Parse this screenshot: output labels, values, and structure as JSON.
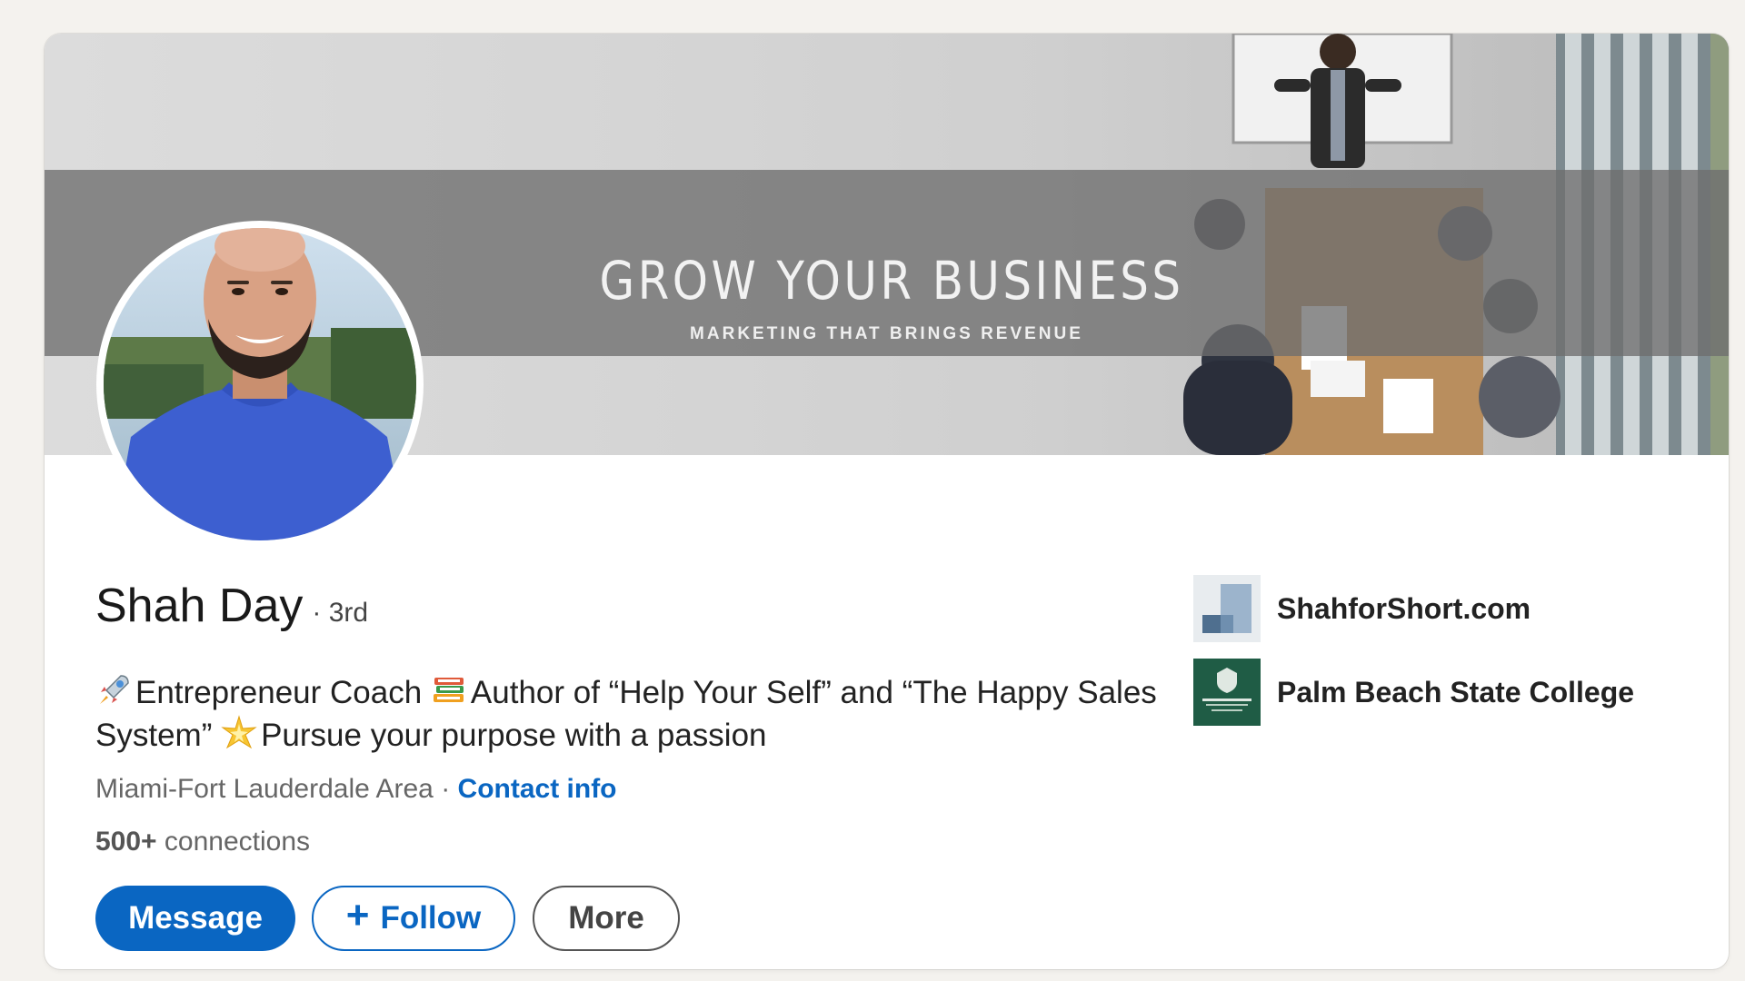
{
  "banner": {
    "title": "GROW YOUR BUSINESS",
    "subtitle": "MARKETING THAT BRINGS REVENUE"
  },
  "profile": {
    "name": "Shah Day",
    "degree": "· 3rd",
    "headline_parts": [
      {
        "emoji": "rocket-icon",
        "text": "Entrepreneur Coach "
      },
      {
        "emoji": "books-icon",
        "text": "Author of “Help Your Self” and “The Happy Sales System” "
      },
      {
        "emoji": "sparkle-icon",
        "text": "Pursue your purpose with a passion"
      }
    ],
    "location": "Miami-Fort Lauderdale Area",
    "separator": "·",
    "contact_label": "Contact info",
    "connections_count": "500+",
    "connections_label": "connections"
  },
  "actions": {
    "message_label": "Message",
    "follow_plus": "+",
    "follow_label": "Follow",
    "more_label": "More"
  },
  "right_column": {
    "company": "ShahforShort.com",
    "school": "Palm Beach State College"
  },
  "colors": {
    "primary": "#0a66c2",
    "page_bg": "#f4f2ee",
    "school_logo": "#1f5c45"
  }
}
